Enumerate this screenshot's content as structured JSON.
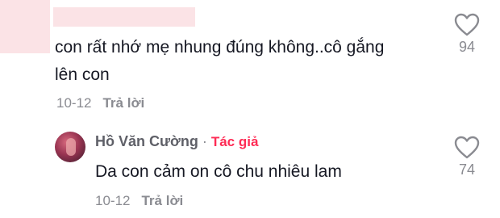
{
  "comment": {
    "text": "con rất nhớ mẹ nhung đúng không..cô gắng lên con",
    "date": "10-12",
    "reply_label": "Trả lời",
    "likes": "94"
  },
  "reply": {
    "author": "Hồ Văn Cường",
    "separator": "·",
    "badge": "Tác giả",
    "text": "Da con cảm on cô chu nhiêu lam",
    "date": "10-12",
    "reply_label": "Trả lời",
    "likes": "74"
  },
  "colors": {
    "accent": "#fe2c55",
    "muted": "#8a8b91",
    "text": "#161823"
  }
}
